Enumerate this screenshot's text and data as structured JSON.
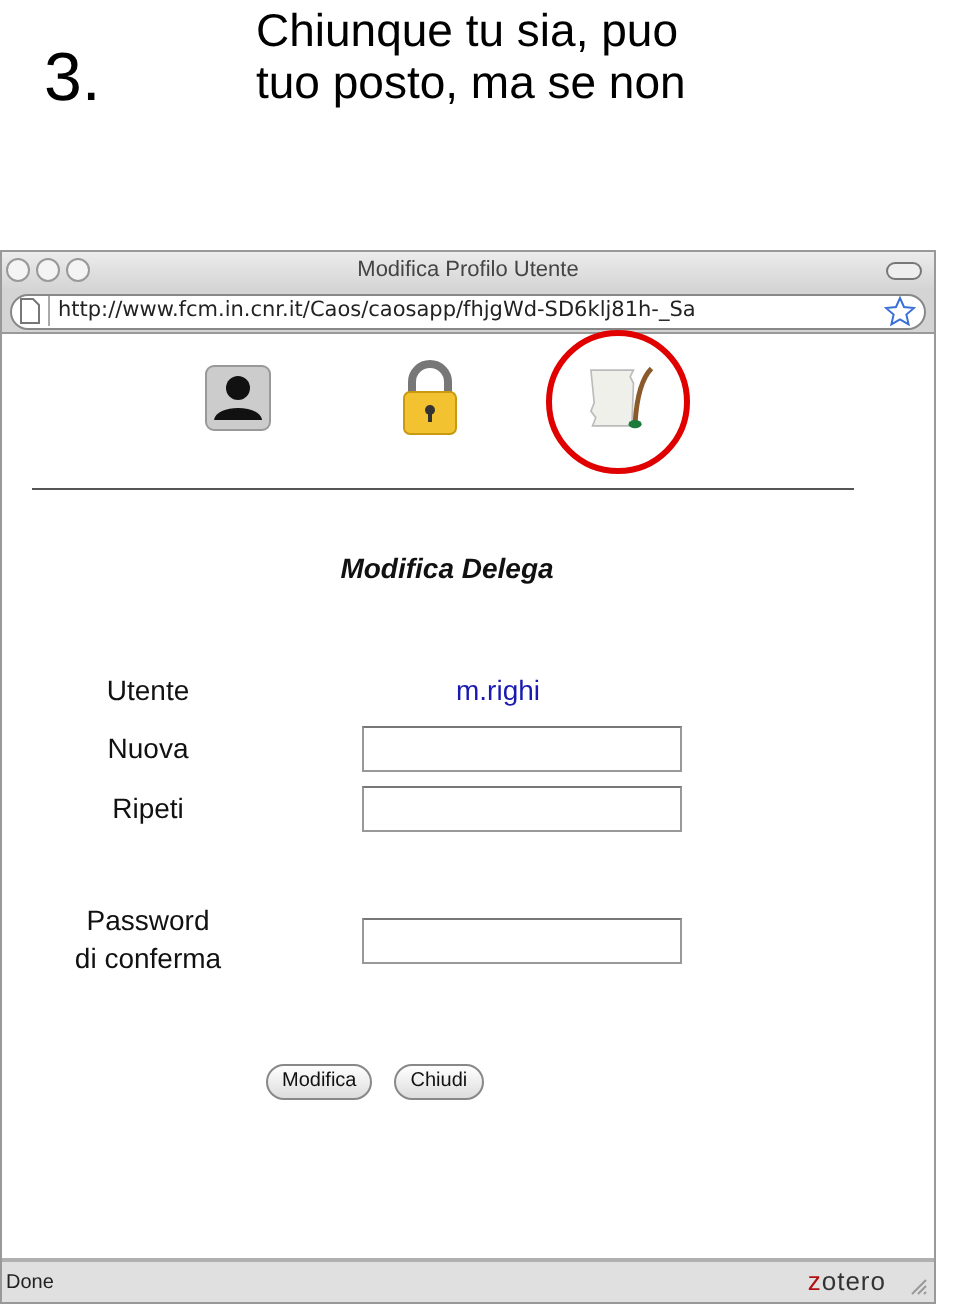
{
  "slide": {
    "number": "3.",
    "lines": [
      "Chiunque tu sia, puo",
      "tuo posto, ma se non"
    ]
  },
  "window": {
    "title": "Modifica Profilo Utente",
    "url": "http://www.fcm.in.cnr.it/Caos/caosapp/fhjgWd-SD6klj81h-_Sa"
  },
  "nav_icons": [
    {
      "kind": "user",
      "highlighted": false
    },
    {
      "kind": "lock",
      "highlighted": false
    },
    {
      "kind": "scroll",
      "highlighted": true
    }
  ],
  "form": {
    "title": "Modifica Delega",
    "rows": [
      {
        "kind": "value",
        "label": "Utente",
        "value": "m.righi"
      },
      {
        "kind": "input",
        "label": "Nuova"
      },
      {
        "kind": "input",
        "label": "Ripeti"
      },
      {
        "kind": "input",
        "label": "Password\ndi conferma"
      }
    ],
    "buttons": [
      "Modifica",
      "Chiudi"
    ]
  },
  "status_bar": {
    "text": "Done",
    "logo": "zotero"
  }
}
